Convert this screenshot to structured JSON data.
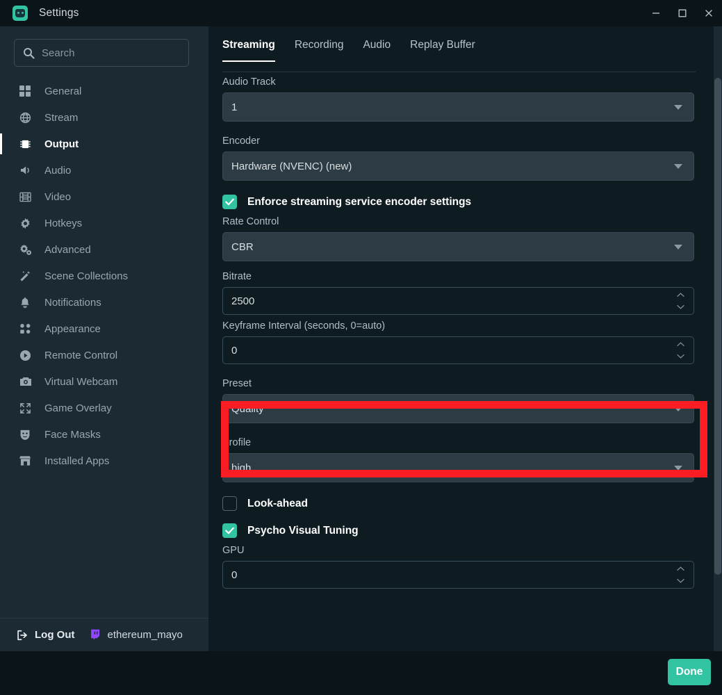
{
  "window": {
    "title": "Settings",
    "logo_icon": "streamlabs-logo-icon",
    "minimize_label": "—",
    "maximize_label": "□",
    "close_label": "✕"
  },
  "sidebar": {
    "search": {
      "placeholder": "Search",
      "value": "",
      "icon": "search-icon"
    },
    "items": [
      {
        "label": "General",
        "icon": "grid-icon",
        "active": false
      },
      {
        "label": "Stream",
        "icon": "globe-icon",
        "active": false
      },
      {
        "label": "Output",
        "icon": "chip-icon",
        "active": true
      },
      {
        "label": "Audio",
        "icon": "speaker-icon",
        "active": false
      },
      {
        "label": "Video",
        "icon": "film-icon",
        "active": false
      },
      {
        "label": "Hotkeys",
        "icon": "gear-icon",
        "active": false
      },
      {
        "label": "Advanced",
        "icon": "gears-icon",
        "active": false
      },
      {
        "label": "Scene Collections",
        "icon": "wand-icon",
        "active": false
      },
      {
        "label": "Notifications",
        "icon": "bell-icon",
        "active": false
      },
      {
        "label": "Appearance",
        "icon": "appearance-icon",
        "active": false
      },
      {
        "label": "Remote Control",
        "icon": "play-circle-icon",
        "active": false
      },
      {
        "label": "Virtual Webcam",
        "icon": "camera-icon",
        "active": false
      },
      {
        "label": "Game Overlay",
        "icon": "expand-icon",
        "active": false
      },
      {
        "label": "Face Masks",
        "icon": "mask-icon",
        "active": false
      },
      {
        "label": "Installed Apps",
        "icon": "store-icon",
        "active": false
      }
    ],
    "footer": {
      "logout_label": "Log Out",
      "logout_icon": "logout-icon",
      "platform_icon": "twitch-icon",
      "username": "ethereum_mayo",
      "platform_color": "#9146ff"
    }
  },
  "main": {
    "tabs": [
      {
        "label": "Streaming",
        "active": true
      },
      {
        "label": "Recording",
        "active": false
      },
      {
        "label": "Audio",
        "active": false
      },
      {
        "label": "Replay Buffer",
        "active": false
      }
    ],
    "fields": {
      "audio_track": {
        "label": "Audio Track",
        "value": "1"
      },
      "encoder": {
        "label": "Encoder",
        "value": "Hardware (NVENC) (new)"
      },
      "enforce": {
        "label": "Enforce streaming service encoder settings",
        "checked": true
      },
      "rate_control": {
        "label": "Rate Control",
        "value": "CBR"
      },
      "bitrate": {
        "label": "Bitrate",
        "value": "2500"
      },
      "keyframe": {
        "label": "Keyframe Interval (seconds, 0=auto)",
        "value": "0"
      },
      "preset": {
        "label": "Preset",
        "value": "Quality"
      },
      "profile": {
        "label": "Profile",
        "value": "high"
      },
      "look_ahead": {
        "label": "Look-ahead",
        "checked": false
      },
      "psycho_visual": {
        "label": "Psycho Visual Tuning",
        "checked": true
      },
      "gpu": {
        "label": "GPU",
        "value": "0"
      }
    }
  },
  "footer": {
    "done_label": "Done"
  },
  "annotation": {
    "highlight_color": "#fa1e24",
    "highlights": [
      "preset"
    ]
  },
  "theme": {
    "accent": "#31c3a2",
    "sidebar_bg": "#1b2a33",
    "main_bg": "#0e1b21",
    "chrome_bg": "#0b1519",
    "field_bg": "#2c3b44"
  }
}
